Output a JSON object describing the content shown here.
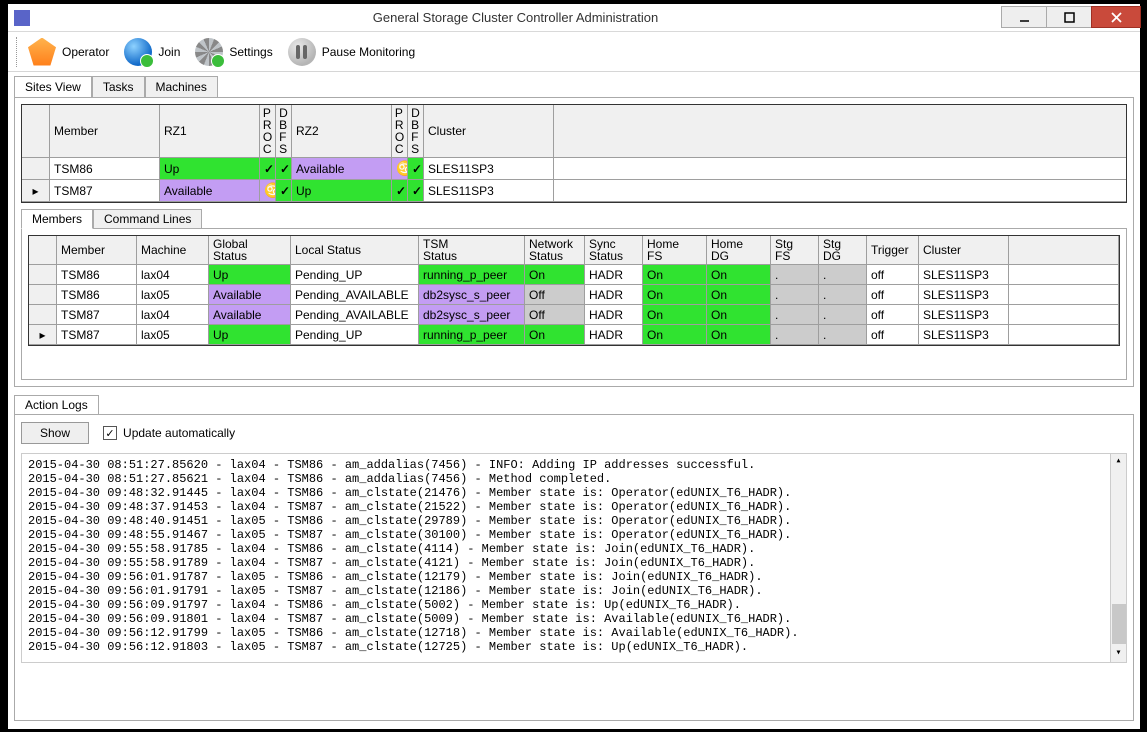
{
  "window": {
    "title": "General Storage Cluster Controller Administration"
  },
  "toolbar": {
    "operator": "Operator",
    "join": "Join",
    "settings": "Settings",
    "pause": "Pause Monitoring"
  },
  "main_tabs": {
    "sites_view": "Sites View",
    "tasks": "Tasks",
    "machines": "Machines"
  },
  "top_grid": {
    "headers": {
      "member": "Member",
      "rz1": "RZ1",
      "proc": "PROC",
      "dbfs": "DBFS",
      "rz2": "RZ2",
      "cluster": "Cluster"
    },
    "rows": [
      {
        "sel": "",
        "member": "TSM86",
        "rz1": "Up",
        "rz1_cls": "green",
        "p1": "chk",
        "d1": "chk",
        "rz2": "Available",
        "rz2_cls": "purple",
        "p2": "cancer",
        "d2": "chk",
        "cluster": "SLES11SP3"
      },
      {
        "sel": "▸",
        "member": "TSM87",
        "rz1": "Available",
        "rz1_cls": "purple",
        "p1": "cancer",
        "d1": "chk",
        "rz2": "Up",
        "rz2_cls": "green",
        "p2": "chk",
        "d2": "chk",
        "cluster": "SLES11SP3"
      }
    ]
  },
  "mid_tabs": {
    "members": "Members",
    "command_lines": "Command Lines"
  },
  "mgrid": {
    "headers": {
      "member": "Member",
      "machine": "Machine",
      "gstatus": "Global\nStatus",
      "lstatus": "Local Status",
      "tsm": "TSM\nStatus",
      "net": "Network\nStatus",
      "sync": "Sync\nStatus",
      "hfs": "Home\nFS",
      "hdg": "Home\nDG",
      "sfs": "Stg\nFS",
      "sdg": "Stg\nDG",
      "trigger": "Trigger",
      "cluster": "Cluster"
    },
    "rows": [
      {
        "sel": "",
        "member": "TSM86",
        "machine": "lax04",
        "gstatus": "Up",
        "gcls": "green",
        "lstatus": "Pending_UP",
        "tsm": "running_p_peer",
        "tcls": "green",
        "net": "On",
        "ncls": "green",
        "sync": "HADR",
        "hfs": "On",
        "hfscls": "green",
        "hdg": "On",
        "hdgcls": "green",
        "sfs": ".",
        "sdg": ".",
        "trigger": "off",
        "cluster": "SLES11SP3"
      },
      {
        "sel": "",
        "member": "TSM86",
        "machine": "lax05",
        "gstatus": "Available",
        "gcls": "purple",
        "lstatus": "Pending_AVAILABLE",
        "tsm": "db2sysc_s_peer",
        "tcls": "purple",
        "net": "Off",
        "ncls": "grey",
        "sync": "HADR",
        "hfs": "On",
        "hfscls": "green",
        "hdg": "On",
        "hdgcls": "green",
        "sfs": ".",
        "sdg": ".",
        "trigger": "off",
        "cluster": "SLES11SP3"
      },
      {
        "sel": "",
        "member": "TSM87",
        "machine": "lax04",
        "gstatus": "Available",
        "gcls": "purple",
        "lstatus": "Pending_AVAILABLE",
        "tsm": "db2sysc_s_peer",
        "tcls": "purple",
        "net": "Off",
        "ncls": "grey",
        "sync": "HADR",
        "hfs": "On",
        "hfscls": "green",
        "hdg": "On",
        "hdgcls": "green",
        "sfs": ".",
        "sdg": ".",
        "trigger": "off",
        "cluster": "SLES11SP3"
      },
      {
        "sel": "▸",
        "member": "TSM87",
        "machine": "lax05",
        "gstatus": "Up",
        "gcls": "green",
        "lstatus": "Pending_UP",
        "tsm": "running_p_peer",
        "tcls": "green",
        "net": "On",
        "ncls": "green",
        "sync": "HADR",
        "hfs": "On",
        "hfscls": "green",
        "hdg": "On",
        "hdgcls": "green",
        "sfs": ".",
        "sdg": ".",
        "trigger": "off",
        "cluster": "SLES11SP3"
      }
    ]
  },
  "log_tab": "Action Logs",
  "show_btn": "Show",
  "auto_chk": "Update automatically",
  "logs": [
    "2015-04-30 08:51:27.85620 - lax04 - TSM86 - am_addalias(7456) - INFO: Adding IP addresses successful.",
    "2015-04-30 08:51:27.85621 - lax04 - TSM86 - am_addalias(7456) - Method completed.",
    "2015-04-30 09:48:32.91445 - lax04 - TSM86 - am_clstate(21476) - Member state is: Operator(edUNIX_T6_HADR).",
    "2015-04-30 09:48:37.91453 - lax04 - TSM87 - am_clstate(21522) - Member state is: Operator(edUNIX_T6_HADR).",
    "2015-04-30 09:48:40.91451 - lax05 - TSM86 - am_clstate(29789) - Member state is: Operator(edUNIX_T6_HADR).",
    "2015-04-30 09:48:55.91467 - lax05 - TSM87 - am_clstate(30100) - Member state is: Operator(edUNIX_T6_HADR).",
    "2015-04-30 09:55:58.91785 - lax04 - TSM86 - am_clstate(4114) - Member state is: Join(edUNIX_T6_HADR).",
    "2015-04-30 09:55:58.91789 - lax04 - TSM87 - am_clstate(4121) - Member state is: Join(edUNIX_T6_HADR).",
    "2015-04-30 09:56:01.91787 - lax05 - TSM86 - am_clstate(12179) - Member state is: Join(edUNIX_T6_HADR).",
    "2015-04-30 09:56:01.91791 - lax05 - TSM87 - am_clstate(12186) - Member state is: Join(edUNIX_T6_HADR).",
    "2015-04-30 09:56:09.91797 - lax04 - TSM86 - am_clstate(5002) - Member state is: Up(edUNIX_T6_HADR).",
    "2015-04-30 09:56:09.91801 - lax04 - TSM87 - am_clstate(5009) - Member state is: Available(edUNIX_T6_HADR).",
    "2015-04-30 09:56:12.91799 - lax05 - TSM86 - am_clstate(12718) - Member state is: Available(edUNIX_T6_HADR).",
    "2015-04-30 09:56:12.91803 - lax05 - TSM87 - am_clstate(12725) - Member state is: Up(edUNIX_T6_HADR)."
  ]
}
